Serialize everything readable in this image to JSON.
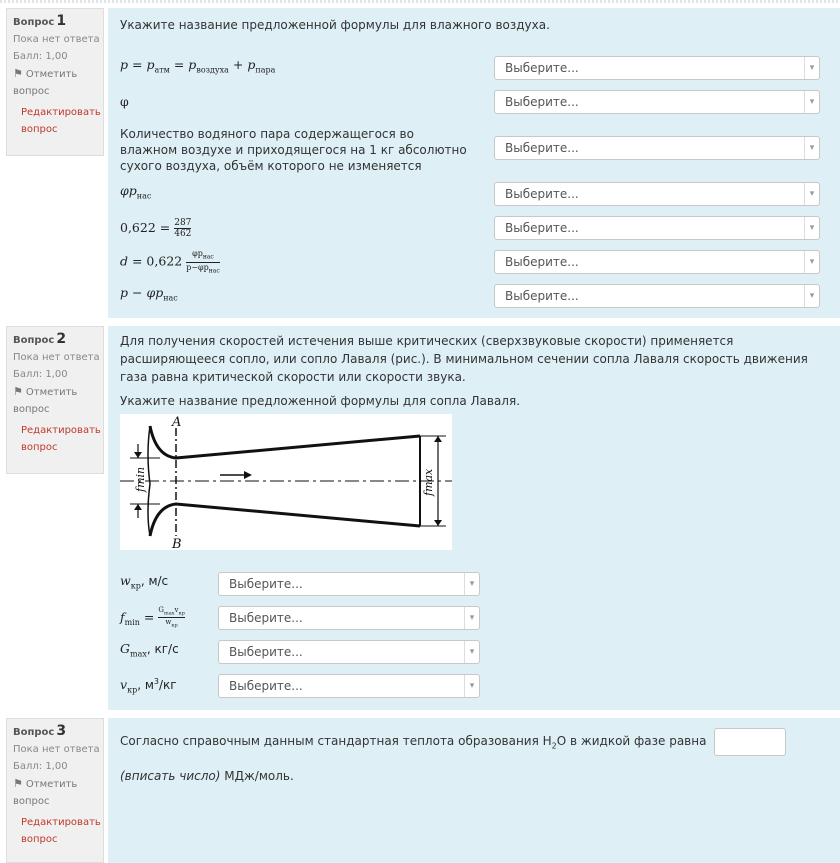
{
  "common": {
    "status": "Пока нет ответа",
    "score": "Балл: 1,00",
    "flag": "Отметить вопрос",
    "edit": "Редактировать вопрос",
    "select_placeholder": "Выберите..."
  },
  "q1": {
    "label": "Вопрос",
    "number": "1",
    "prompt": "Укажите название предложенной формулы для влажного воздуха.",
    "rows": [
      "p = pатм = pвоздуха + pпара",
      "φ",
      "Количество водяного пара содержащегося во влажном воздухе и приходящегося на 1 кг абсолютно сухого воздуха, объём которого не изменяется",
      "φpнас",
      "0,622 = 287/462",
      "d = 0,622 φpнас/(p−φpнас)",
      "p − φpнас"
    ]
  },
  "q2": {
    "label": "Вопрос",
    "number": "2",
    "intro": "Для получения скоростей истечения выше критических (сверхзвуковые скорости) применяется расширяющееся сопло, или сопло Лаваля (рис.). В минимальном сечении сопла Лаваля скорость движения газа равна критической скорости или скорости звука.",
    "prompt": "Укажите название предложенной формулы для сопла Лаваля.",
    "figure": {
      "A": "A",
      "B": "B",
      "fmin": "fmin",
      "fmax": "fmax"
    },
    "rows": [
      "wкр, м/с",
      "fmin = Gmax vкр / wкр",
      "Gmax, кг/с",
      "vкр, м³/кг"
    ]
  },
  "q3": {
    "label": "Вопрос",
    "number": "3",
    "text_before": "Согласно справочным данным стандартная теплота образования H",
    "sub": "2",
    "text_mid": "O в жидкой фазе равна",
    "hint": "(вписать число)",
    "text_after": "МДж/моль."
  }
}
